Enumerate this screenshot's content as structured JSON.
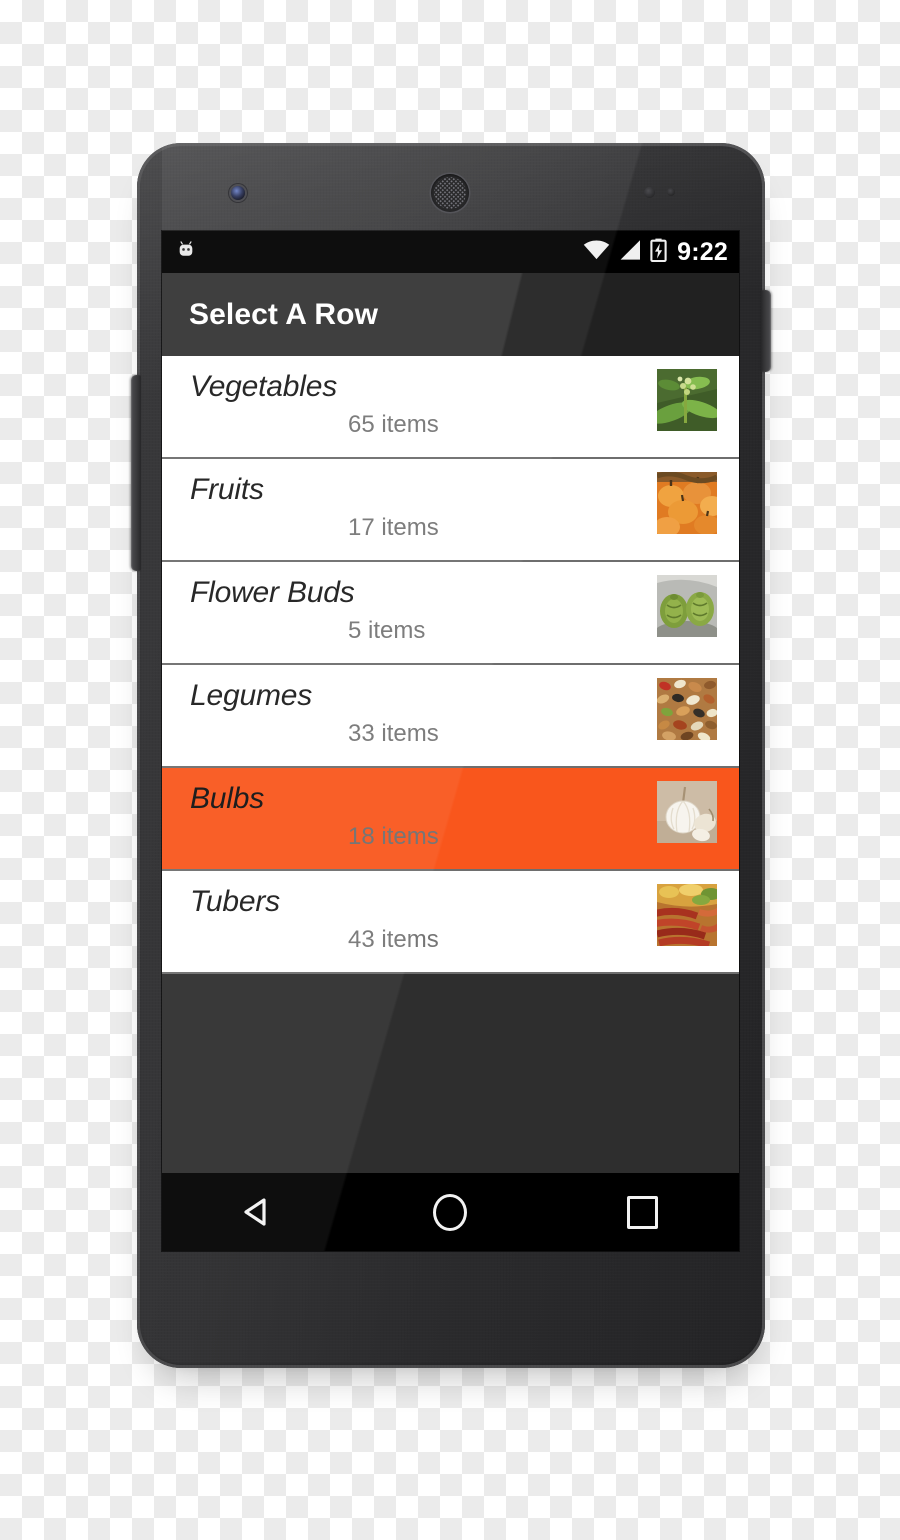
{
  "device": {
    "name": "android-phone",
    "hardware": {
      "front_camera": "front-camera",
      "earpiece": "earpiece-speaker",
      "proximity_sensor": "proximity-sensor",
      "light_sensor": "light-sensor",
      "volume_rocker": "volume-rocker",
      "power_button": "power-button"
    }
  },
  "status_bar": {
    "notification_icon": "android-robot-icon",
    "wifi_icon": "wifi-icon",
    "signal_icon": "cell-signal-icon",
    "battery_icon": "battery-charging-icon",
    "time": "9:22"
  },
  "action_bar": {
    "title": "Select A Row"
  },
  "colors": {
    "accent_selected": "#f9561c",
    "action_bar": "#212121",
    "status_bar": "#000000",
    "list_background": "#2e2e2e",
    "row_background": "#ffffff",
    "divider": "#6e6e6e",
    "title_text": "#1c1c1c",
    "subtitle_text": "#757575"
  },
  "list": {
    "rows": [
      {
        "title": "Vegetables",
        "subtitle": "65 items",
        "thumb": "leafy-greens-thumbnail",
        "selected": false
      },
      {
        "title": "Fruits",
        "subtitle": "17 items",
        "thumb": "pumpkins-thumbnail",
        "selected": false
      },
      {
        "title": "Flower Buds",
        "subtitle": "5 items",
        "thumb": "artichokes-thumbnail",
        "selected": false
      },
      {
        "title": "Legumes",
        "subtitle": "33 items",
        "thumb": "mixed-beans-thumbnail",
        "selected": false
      },
      {
        "title": "Bulbs",
        "subtitle": "18 items",
        "thumb": "garlic-thumbnail",
        "selected": true
      },
      {
        "title": "Tubers",
        "subtitle": "43 items",
        "thumb": "root-vegetables-thumbnail",
        "selected": false
      }
    ]
  },
  "nav_bar": {
    "back_label": "Back",
    "home_label": "Home",
    "recents_label": "Recents"
  }
}
